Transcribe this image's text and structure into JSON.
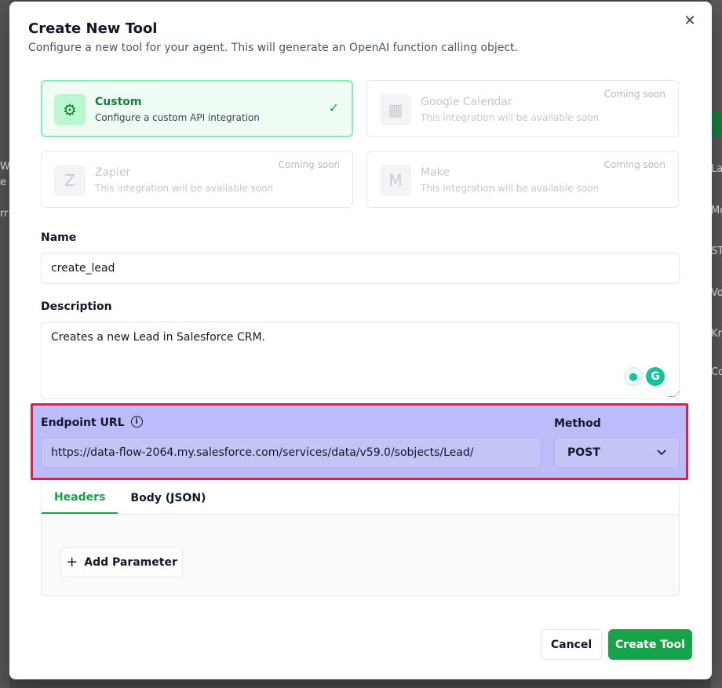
{
  "background": {
    "right_fragments": [
      "La",
      "Mo",
      "ST",
      "Vo",
      "Kn",
      "Co"
    ],
    "left_fragments": [
      "W",
      "e",
      "rr"
    ]
  },
  "modal": {
    "title": "Create New Tool",
    "subtitle": "Configure a new tool for your agent. This will generate an OpenAI function calling object.",
    "close_icon": "✕"
  },
  "integrations": [
    {
      "icon": "gear-icon",
      "glyph": "⚙",
      "title": "Custom",
      "description": "Configure a custom API integration",
      "selected": true,
      "badge": ""
    },
    {
      "icon": "calendar-icon",
      "glyph": "▦",
      "title": "Google Calendar",
      "description": "This integration will be available soon",
      "selected": false,
      "badge": "Coming soon"
    },
    {
      "icon": "zapier-icon",
      "glyph": "Z",
      "title": "Zapier",
      "description": "This integration will be available soon",
      "selected": false,
      "badge": "Coming soon"
    },
    {
      "icon": "make-icon",
      "glyph": "M",
      "title": "Make",
      "description": "This integration will be available soon",
      "selected": false,
      "badge": "Coming soon"
    }
  ],
  "form": {
    "name_label": "Name",
    "name_value": "create_lead",
    "description_label": "Description",
    "description_value": "Creates a new Lead in Salesforce CRM.",
    "endpoint_label": "Endpoint URL",
    "endpoint_value": "https://data-flow-2064.my.salesforce.com/services/data/v59.0/sobjects/Lead/",
    "method_label": "Method",
    "method_value": "POST"
  },
  "tabs": [
    {
      "label": "Headers",
      "active": true
    },
    {
      "label": "Body (JSON)",
      "active": false
    }
  ],
  "add_parameter_label": "Add Parameter",
  "footer": {
    "cancel_label": "Cancel",
    "create_label": "Create Tool"
  },
  "colors": {
    "accent": "#16a34a",
    "highlight_fill": "#bcbcfa",
    "highlight_border": "#e11d48"
  }
}
